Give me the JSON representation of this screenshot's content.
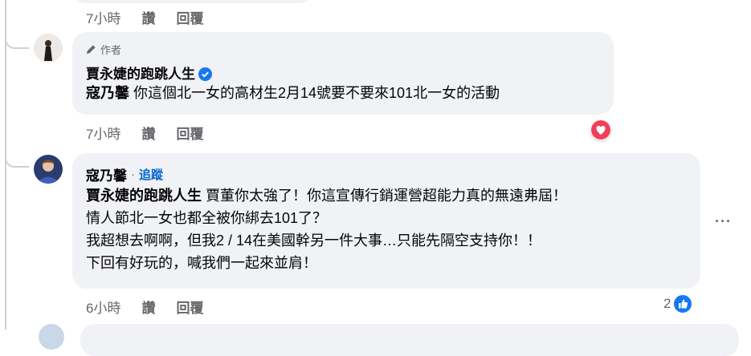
{
  "top_comment": {
    "time": "7小時",
    "read_label": "讚",
    "reply_label": "回覆"
  },
  "author_comment": {
    "author_badge": "作者",
    "name": "賈永婕的跑跳人生",
    "mention": "寇乃馨",
    "text": "你這個北一女的高材生2月14號要不要來101北一女的活動",
    "time": "7小時",
    "like_label": "讚",
    "reply_label": "回覆",
    "reaction_icon": "love-reaction-icon"
  },
  "reply_comment": {
    "name": "寇乃馨",
    "separator": "·",
    "follow_label": "追蹤",
    "mention": "賈永婕的跑跳人生",
    "line1": "賈董你太強了！你這宣傳行銷運營超能力真的無遠弗屆！",
    "line2": "情人節北一女也都全被你綁去101了？",
    "line3": "我超想去啊啊，但我2 / 14在美國幹另一件大事…只能先隔空支持你！！",
    "line4": "下回有好玩的，喊我們一起來並肩！",
    "time": "6小時",
    "like_label": "讚",
    "reply_label": "回覆",
    "reaction_count": "2",
    "reaction_icon": "like-reaction-icon",
    "more_label": "···"
  },
  "colors": {
    "bubble_bg": "#f0f2f5",
    "meta_text": "#65676b",
    "link_blue": "#0064d1",
    "verified_blue": "#1877f2",
    "love_red": "#f33e58"
  }
}
